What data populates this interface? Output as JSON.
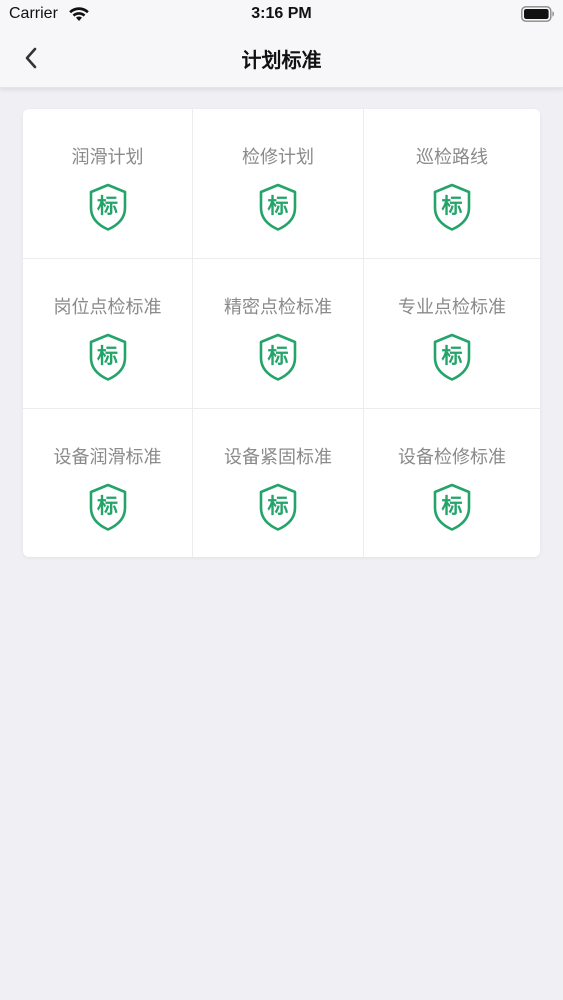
{
  "status_bar": {
    "carrier": "Carrier",
    "time": "3:16 PM"
  },
  "nav": {
    "title": "计划标准",
    "back_icon": "chevron-left-icon"
  },
  "theme": {
    "accent": "#24a46a",
    "label_color": "#8a8a8a",
    "background": "#f0eff4"
  },
  "grid": {
    "badge_text": "标",
    "badge_icon": "shield-icon",
    "items": [
      {
        "label": "润滑计划"
      },
      {
        "label": "检修计划"
      },
      {
        "label": "巡检路线"
      },
      {
        "label": "岗位点检标准"
      },
      {
        "label": "精密点检标准"
      },
      {
        "label": "专业点检标准"
      },
      {
        "label": "设备润滑标准"
      },
      {
        "label": "设备紧固标准"
      },
      {
        "label": "设备检修标准"
      }
    ]
  }
}
